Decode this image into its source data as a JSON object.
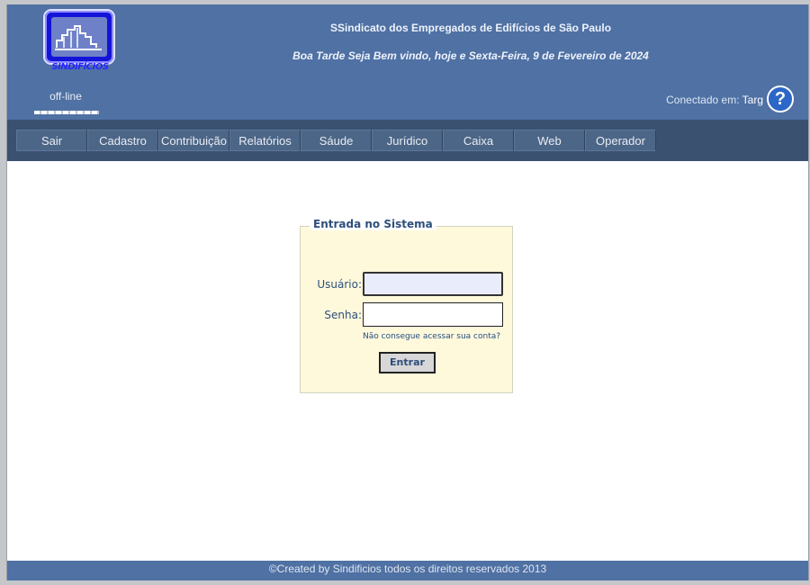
{
  "header": {
    "logo_text": "SINDIFÍCIOS",
    "status": "off-line",
    "org_name": "SSindicato dos Empregados de Edifícios de São Paulo",
    "greeting": "Boa Tarde Seja Bem vindo, hoje e Sexta-Feira, 9 de Fevereiro de 2024",
    "connected_label": "Conectado em:",
    "connected_value": "Targ",
    "help_glyph": "?"
  },
  "nav": {
    "items": [
      {
        "label": "Sair"
      },
      {
        "label": "Cadastro"
      },
      {
        "label": "Contribuição"
      },
      {
        "label": "Relatórios"
      },
      {
        "label": "Sáude"
      },
      {
        "label": "Jurídico"
      },
      {
        "label": "Caixa"
      },
      {
        "label": "Web"
      },
      {
        "label": "Operador"
      }
    ]
  },
  "login": {
    "legend": "Entrada no Sistema",
    "user_label": "Usuário:",
    "user_value": "",
    "pass_label": "Senha:",
    "pass_value": "",
    "forgot_link": "Não consegue acessar sua conta?",
    "submit_label": "Entrar"
  },
  "footer": {
    "text": "©Created by Sindificios todos os direitos reservados 2013"
  },
  "colors": {
    "header_bg": "#4f71a4",
    "nav_bg": "#3b5170",
    "login_panel_bg": "#fff9dc",
    "accent_text": "#2d4f7c"
  }
}
